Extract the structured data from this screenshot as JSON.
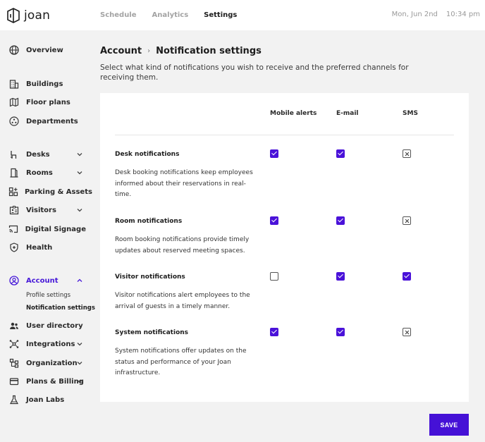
{
  "brand": {
    "name": "joan"
  },
  "topnav": {
    "schedule": "Schedule",
    "analytics": "Analytics",
    "settings": "Settings"
  },
  "datetime": {
    "date": "Mon, Jun 2nd",
    "time": "10:34 pm"
  },
  "sidebar": {
    "overview": "Overview",
    "buildings": "Buildings",
    "floor_plans": "Floor plans",
    "departments": "Departments",
    "desks": "Desks",
    "rooms": "Rooms",
    "parking": "Parking & Assets",
    "visitors": "Visitors",
    "digital_signage": "Digital Signage",
    "health": "Health",
    "account": "Account",
    "profile_settings": "Profile settings",
    "notification_settings": "Notification settings",
    "user_directory": "User directory",
    "integrations": "Integrations",
    "organization": "Organization",
    "plans_billing": "Plans & Billing",
    "joan_labs": "Joan Labs"
  },
  "breadcrumb": {
    "parent": "Account",
    "current": "Notification settings"
  },
  "subtitle": "Select what kind of notifications you wish to receive and the preferred channels for receiving them.",
  "columns": {
    "mobile": "Mobile alerts",
    "email": "E-mail",
    "sms": "SMS"
  },
  "rows": [
    {
      "title": "Desk notifications",
      "desc": "Desk booking notifications keep employees informed about their reservations in real-time.",
      "mobile": "checked",
      "email": "checked",
      "sms": "disabled"
    },
    {
      "title": "Room notifications",
      "desc": "Room booking notifications provide timely updates about reserved meeting spaces.",
      "mobile": "checked",
      "email": "checked",
      "sms": "disabled"
    },
    {
      "title": "Visitor notifications",
      "desc": "Visitor notifications alert employees to the arrival of guests in a timely manner.",
      "mobile": "unchecked",
      "email": "checked",
      "sms": "checked"
    },
    {
      "title": "System notifications",
      "desc": "System notifications offer updates on the status and performance of your Joan infrastructure.",
      "mobile": "checked",
      "email": "checked",
      "sms": "disabled"
    }
  ],
  "save_label": "SAVE",
  "colors": {
    "accent": "#4a12d9"
  }
}
